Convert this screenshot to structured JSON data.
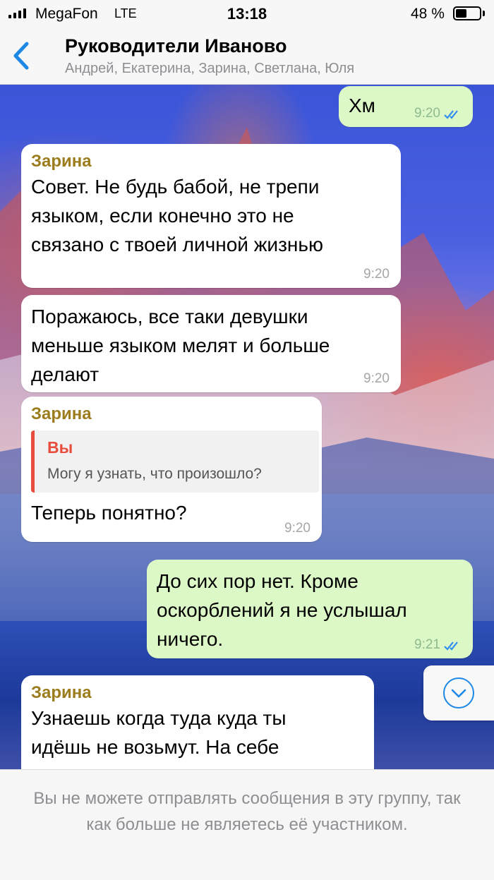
{
  "status_bar": {
    "carrier": "MegaFon",
    "network": "LTE",
    "time": "13:18",
    "battery_percent_text": "48 %",
    "battery_level": 0.48
  },
  "header": {
    "back_icon": "chevron-left-icon",
    "title": "Руководители Иваново",
    "members": "Андрей, Екатерина, Зарина, Светлана, Юля"
  },
  "messages": [
    {
      "direction": "out",
      "text": "Хм",
      "time": "9:20",
      "status_icon": "double-check-icon"
    },
    {
      "direction": "in",
      "sender": "Зарина",
      "text_lines": [
        "Совет. Не будь бабой, не трепи",
        "языком, если конечно это не",
        "связано с твоей личной жизнью"
      ],
      "time": "9:20"
    },
    {
      "direction": "in",
      "text_lines": [
        "Поражаюсь, все таки девушки",
        "меньше языком мелят и больше",
        "делают"
      ],
      "time": "9:20"
    },
    {
      "direction": "in",
      "sender": "Зарина",
      "reply": {
        "name": "Вы",
        "text": "Могу я узнать, что произошло?"
      },
      "text": "Теперь понятно?",
      "time": "9:20"
    },
    {
      "direction": "out",
      "text_lines": [
        "До сих пор нет. Кроме",
        "оскорблений я не услышал",
        "ничего."
      ],
      "time": "9:21",
      "status_icon": "double-check-icon"
    },
    {
      "direction": "in",
      "sender": "Зарина",
      "text_lines": [
        "Узнаешь когда туда куда ты",
        "идёшь не возьмут. На себе"
      ]
    }
  ],
  "scroll_down_icon": "chevron-down-circle-icon",
  "footer": {
    "notice": "Вы не можете отправлять сообщения в эту группу, так как больше не являетесь её участником."
  },
  "colors": {
    "accent": "#1e88e5",
    "incoming_bubble": "#ffffff",
    "outgoing_bubble": "#dcf8c6",
    "sender_name": "#9b7d1e",
    "reply_name": "#e74c3c"
  }
}
